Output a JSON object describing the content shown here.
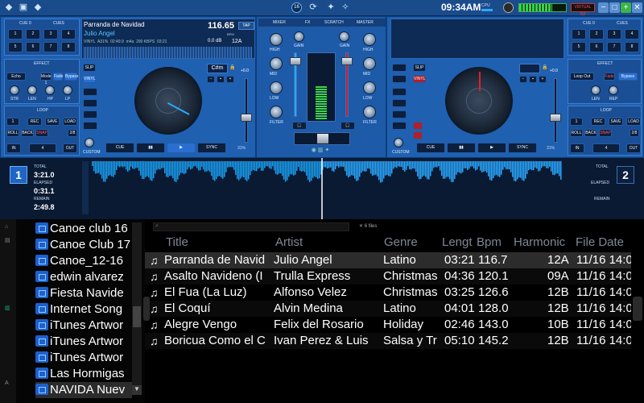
{
  "topbar": {
    "clock": "09:34AM",
    "cpu_label": "CPU",
    "badge": "VIRTUAL DJ",
    "deck_indicator": "16"
  },
  "deck_left": {
    "cue_label": "CUE 0",
    "cues_label": "CUES",
    "hotcues": [
      "1",
      "2",
      "3",
      "4",
      "5",
      "6",
      "7",
      "8"
    ],
    "title": "Parranda de Navidad",
    "artist": "Julio Angel",
    "bpm": "116.65",
    "bpm_unit": "BPM",
    "tap": "TAP",
    "gain_db": "0.0 dB",
    "key": "12A",
    "key_display": "C#m",
    "info": [
      "VINYL",
      "A31%",
      "02:49.9",
      "m4a",
      "290 KBPS",
      "03:21"
    ],
    "pitch": "+0.0",
    "pitch_range": "31%",
    "effect_title": "EFFECT",
    "effect_name": "Echo",
    "effect_sub": [
      "Mode 1",
      "Fade",
      "Bypass"
    ],
    "effect_knobs": [
      "STR",
      "LEN",
      "HP",
      "LP"
    ],
    "loop_title": "LOOP",
    "loop_btns": [
      "REC",
      "SAVE",
      "LOAD"
    ],
    "loop_btns2": [
      "ROLL",
      "BACK",
      "SNAP",
      "2/8"
    ],
    "loop_size": "1",
    "transport": [
      "CUE",
      "▮▮",
      "▶",
      "SYNC"
    ],
    "in": "IN",
    "out": "OUT",
    "nav": "4",
    "slip": "SLIP",
    "vinyl": "VINYL",
    "custom": "CUSTOM",
    "deck_num": "1",
    "total_label": "TOTAL",
    "total": "3:21.0",
    "elapsed_label": "ELAPSED",
    "elapsed": "0:31.1",
    "remain_label": "REMAIN",
    "remain": "2:49.8"
  },
  "deck_right": {
    "cue_label": "CUE 0",
    "cues_label": "CUES",
    "hotcues": [
      "1",
      "2",
      "3",
      "4",
      "5",
      "6",
      "7",
      "8"
    ],
    "pitch": "+0.0",
    "pitch_range": "31%",
    "effect_title": "EFFECT",
    "effect_name": "Loop Out",
    "effect_sub": [
      "Fade",
      "Bypass"
    ],
    "effect_knobs": [
      "LEN",
      "REP"
    ],
    "loop_title": "LOOP",
    "loop_btns": [
      "REC",
      "SAVE",
      "LOAD"
    ],
    "loop_btns2": [
      "ROLL",
      "BACK",
      "SNAP",
      "2/8"
    ],
    "loop_size": "1",
    "transport": [
      "CUE",
      "▮▮",
      "▶",
      "SYNC"
    ],
    "in": "IN",
    "out": "OUT",
    "nav": "4",
    "slip": "SLIP",
    "vinyl": "VINYL",
    "custom": "CUSTOM",
    "deck_num": "2",
    "total_label": "TOTAL",
    "elapsed_label": "ELAPSED",
    "remain_label": "REMAIN"
  },
  "mixer": {
    "tabs": [
      "MIXER",
      "FX",
      "SCRATCH",
      "MASTER"
    ],
    "left_labels": [
      "HIGH",
      "MID",
      "LOW",
      "FILTER"
    ],
    "right_labels": [
      "HIGH",
      "MID",
      "LOW",
      "FILTER"
    ],
    "gain": "GAIN",
    "master": "MASTER"
  },
  "browser": {
    "search_placeholder": "",
    "file_count": "6 files",
    "columns": [
      "Title",
      "Artist",
      "Genre",
      "Lengt",
      "Bpm",
      "Harmonic",
      "File Date"
    ],
    "folders": [
      "Canoe club 16",
      "Canoe Club 17",
      "Canoe_12-16",
      "edwin alvarez",
      "Fiesta Navide",
      "Internet Song",
      "iTunes Artwor",
      "iTunes Artwor",
      "iTunes Artwor",
      "Las Hormigas",
      "NAVIDA Nuev"
    ],
    "tracks": [
      {
        "title": "Parranda de Navid",
        "artist": "Julio Angel",
        "genre": "Latino",
        "length": "03:21",
        "bpm": "116.7",
        "key": "12A",
        "date": "11/16 14:0"
      },
      {
        "title": "Asalto Navideno (I",
        "artist": "Trulla Express",
        "genre": "Christmas",
        "length": "04:36",
        "bpm": "120.1",
        "key": "09A",
        "date": "11/16 14:0"
      },
      {
        "title": "El Fua (La Luz)",
        "artist": "Alfonso Velez",
        "genre": "Christmas",
        "length": "03:25",
        "bpm": "126.6",
        "key": "12B",
        "date": "11/16 14:0"
      },
      {
        "title": "El Coquí",
        "artist": "Alvin Medina",
        "genre": "Latino",
        "length": "04:01",
        "bpm": "128.0",
        "key": "12B",
        "date": "11/16 14:0"
      },
      {
        "title": "Alegre Vengo",
        "artist": "Felix del Rosario",
        "genre": "Holiday",
        "length": "02:46",
        "bpm": "143.0",
        "key": "10B",
        "date": "11/16 14:0"
      },
      {
        "title": "Boricua Como el C",
        "artist": "Ivan Perez  & Luis",
        "genre": "Salsa y Tr",
        "length": "05:10",
        "bpm": "145.2",
        "key": "12B",
        "date": "11/16 14:0"
      }
    ]
  },
  "colors": {
    "accent": "#2aa8ff",
    "deck_bg": "#1f60b0",
    "waveform": "#1a9ff0",
    "selected_row": "#2c2c2c"
  }
}
